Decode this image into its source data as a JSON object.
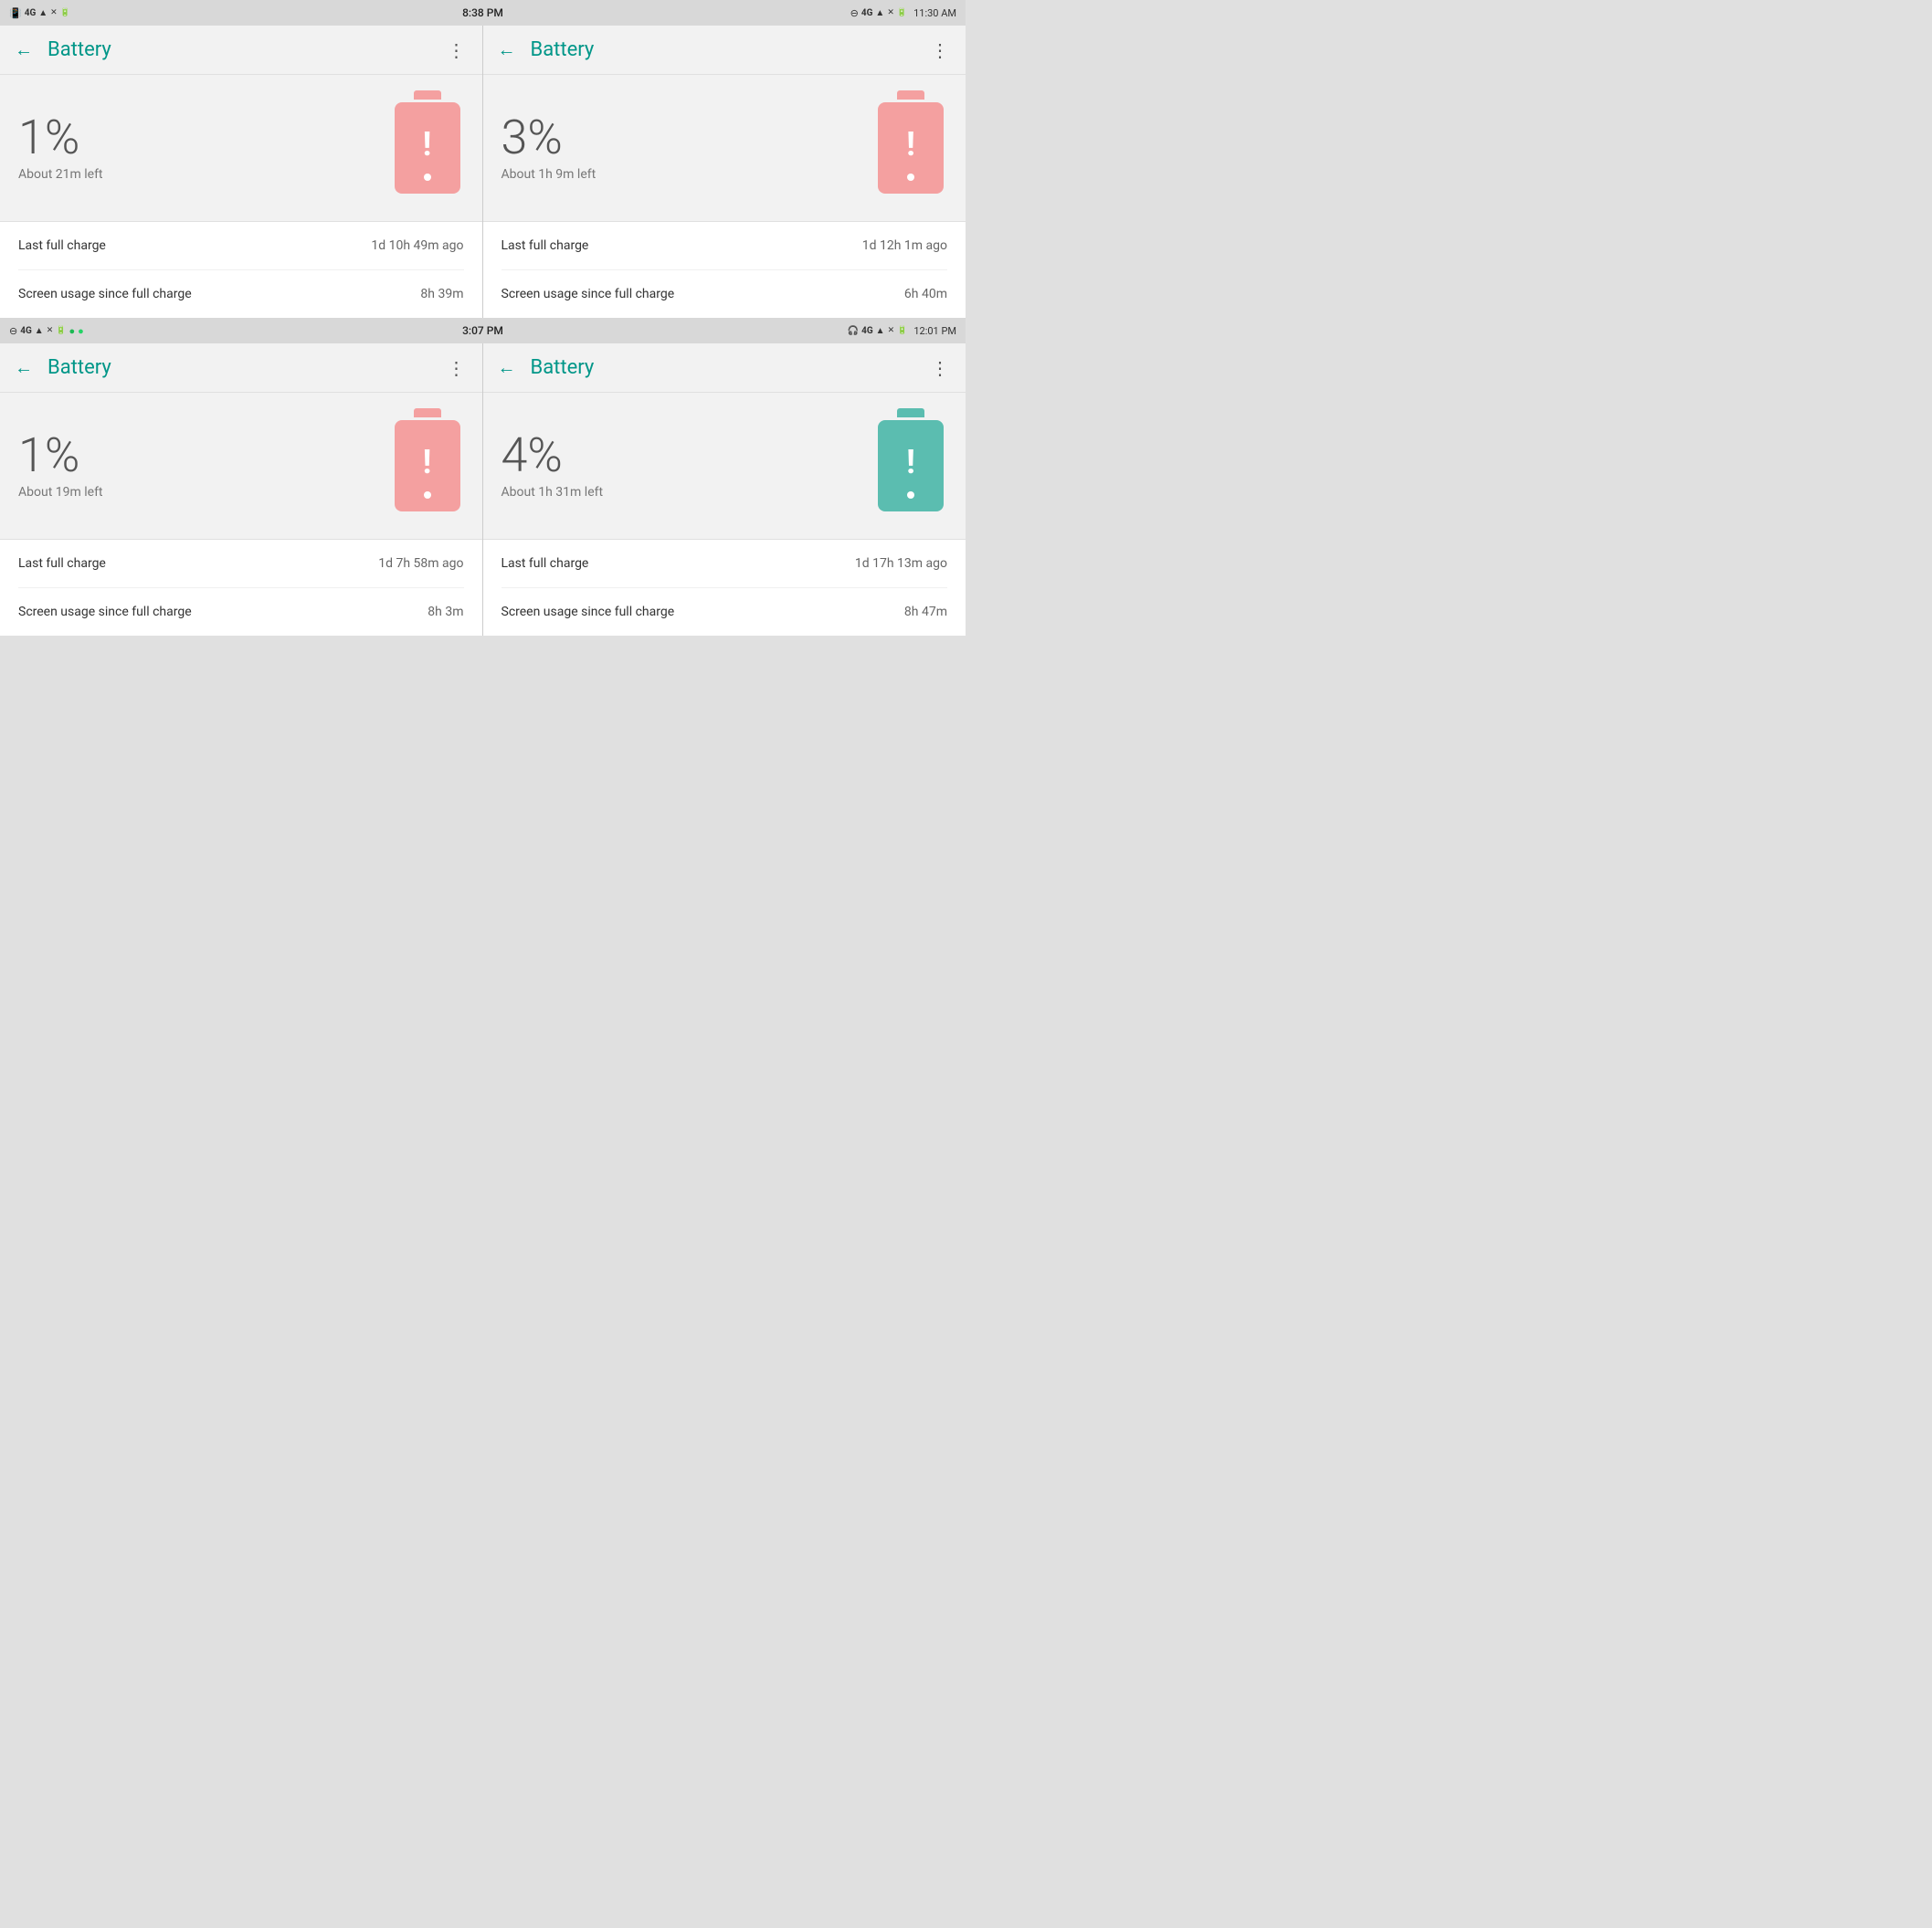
{
  "statusBar1": {
    "leftIcons": "📳 4G ╳ ⊖",
    "time": "8:38 PM",
    "rightIcons": "⊖ 4G ╳ 🔋 11:30 AM"
  },
  "statusBar2": {
    "leftIcons": "⊖ 4G ╳",
    "time": "3:07 PM",
    "rightIcons": "🎧 4G ╳ 🔋 12:01 PM"
  },
  "panels": [
    {
      "id": "top-left",
      "title": "Battery",
      "percent": "1%",
      "timeLeft": "About 21m left",
      "iconColor": "pink",
      "lastFullCharge": "1d 10h 49m ago",
      "screenUsage": "8h 39m"
    },
    {
      "id": "top-right",
      "title": "Battery",
      "percent": "3%",
      "timeLeft": "About 1h 9m left",
      "iconColor": "pink",
      "lastFullCharge": "1d 12h 1m ago",
      "screenUsage": "6h 40m"
    },
    {
      "id": "bottom-left",
      "title": "Battery",
      "percent": "1%",
      "timeLeft": "About 19m left",
      "iconColor": "pink",
      "lastFullCharge": "1d 7h 58m ago",
      "screenUsage": "8h 3m"
    },
    {
      "id": "bottom-right",
      "title": "Battery",
      "percent": "4%",
      "timeLeft": "About 1h 31m left",
      "iconColor": "teal",
      "lastFullCharge": "1d 17h 13m ago",
      "screenUsage": "8h 47m"
    }
  ],
  "labels": {
    "lastFullCharge": "Last full charge",
    "screenUsage": "Screen usage since full charge",
    "back": "←",
    "moreDots": "⋮"
  }
}
